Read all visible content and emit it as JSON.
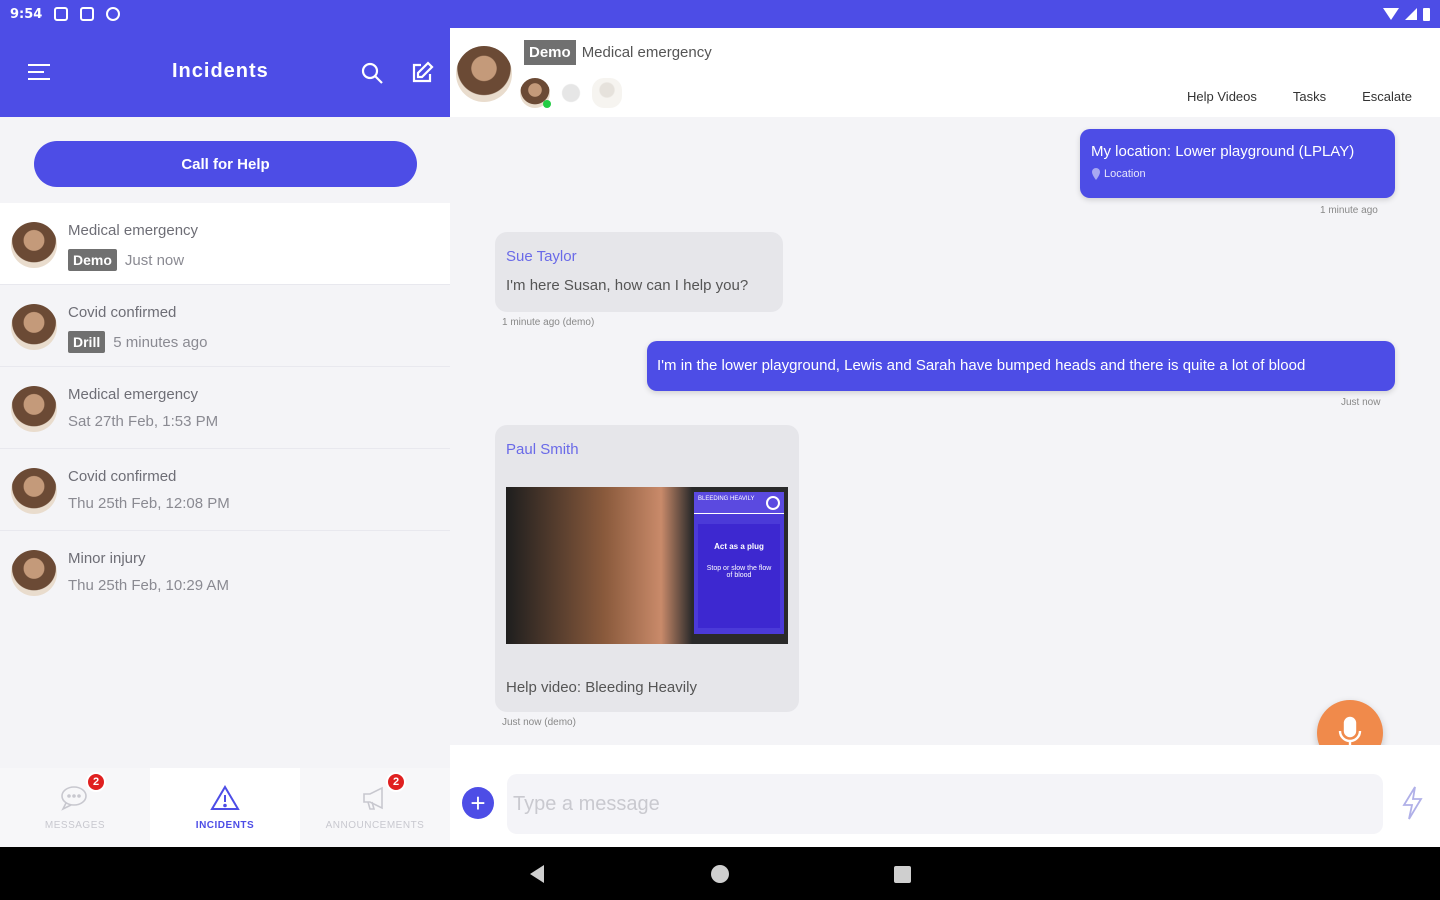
{
  "status_bar": {
    "time": "9:54"
  },
  "sidebar": {
    "title": "Incidents",
    "call_for_help": "Call for Help",
    "incidents": [
      {
        "title": "Medical emergency",
        "tag": "Demo",
        "time": "Just now",
        "active": true
      },
      {
        "title": "Covid confirmed",
        "tag": "Drill",
        "time": "5 minutes ago"
      },
      {
        "title": "Medical emergency",
        "tag": "",
        "time": "Sat 27th Feb, 1:53 PM"
      },
      {
        "title": "Covid confirmed",
        "tag": "",
        "time": "Thu 25th Feb, 12:08 PM"
      },
      {
        "title": "Minor injury",
        "tag": "",
        "time": "Thu 25th Feb, 10:29 AM"
      }
    ]
  },
  "bottom_nav": {
    "messages": {
      "label": "MESSAGES",
      "badge": "2"
    },
    "incidents": {
      "label": "INCIDENTS"
    },
    "announcements": {
      "label": "ANNOUNCEMENTS",
      "badge": "2"
    }
  },
  "chat": {
    "tag": "Demo",
    "title": "Medical emergency",
    "actions": {
      "help_videos": "Help Videos",
      "tasks": "Tasks",
      "escalate": "Escalate"
    },
    "messages": {
      "m1": {
        "text": "My location: Lower playground (LPLAY)",
        "sub": "Location",
        "stamp": "1 minute ago"
      },
      "m2": {
        "sender": "Sue Taylor",
        "text": "I'm here Susan, how can I help you?",
        "stamp": "1 minute ago (demo)"
      },
      "m3": {
        "text": "I'm in the lower playground, Lewis and Sarah have bumped heads and there is quite a lot of blood",
        "stamp": "Just now"
      },
      "m4": {
        "sender": "Paul Smith",
        "video_panel_title": "BLEEDING HEAVILY",
        "video_panel_line1": "Act as a plug",
        "video_panel_line2": "Stop or slow the flow of blood",
        "caption": "Help video: Bleeding Heavily",
        "stamp": "Just now (demo)"
      }
    },
    "composer": {
      "placeholder": "Type a message"
    }
  },
  "colors": {
    "brand": "#4d4de6",
    "mic": "#f08a4b",
    "badge": "#e02020"
  }
}
